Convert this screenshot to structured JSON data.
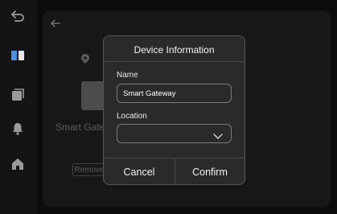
{
  "background": {
    "device_name": "Smart Gateway",
    "remove_label": "Remove"
  },
  "dialog": {
    "title": "Device Information",
    "name_label": "Name",
    "name_value": "Smart Gateway",
    "location_label": "Location",
    "location_value": "",
    "cancel_label": "Cancel",
    "confirm_label": "Confirm"
  },
  "icons": {
    "back": "back-icon",
    "devices": "devices-icon",
    "scenes": "scenes-icon",
    "alerts": "bell-icon",
    "home": "home-icon",
    "nav_back": "arrow-left-icon",
    "location_pin": "location-pin-icon",
    "dropdown": "chevron-down-icon"
  }
}
